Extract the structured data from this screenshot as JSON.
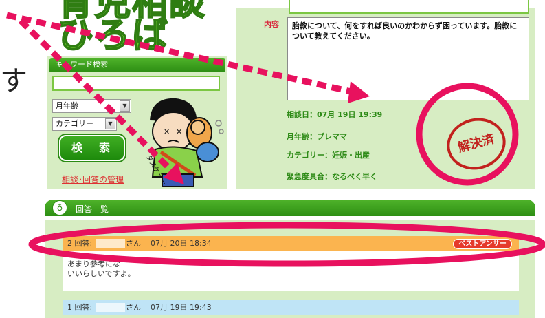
{
  "edge_text": "す",
  "logo": {
    "line1": "育児相談",
    "line2": "ひろば"
  },
  "sidebar": {
    "keyword_header": "キーワード検索",
    "month_select": "月年齢",
    "category_select": "カテゴリー",
    "search_button": "検　索",
    "manage_link": "相談･回答の管理",
    "character_caption": "タスケテー"
  },
  "consultation": {
    "content_label": "内容",
    "content_text": "胎教について、何をすれば良いのかわからず困っています。胎教について教えてください。",
    "date": "相談日：07月 19日 19:39",
    "age": "月年齢：プレママ",
    "category": "カテゴリー：妊娠・出産",
    "urgency": "緊急度具合：なるべく早く",
    "stamp": "解決済"
  },
  "answers": {
    "title": "回答一覧",
    "items": [
      {
        "number": "2 回答:",
        "user_suffix": "さん",
        "date": "07月 20日 18:34",
        "badge": "ベストアンサー",
        "body_start": "あまり参考にな",
        "body_end": "いいらしいですよ。"
      },
      {
        "number": "1 回答:",
        "user_suffix": "さん",
        "date": "07月 19日 19:43"
      }
    ]
  },
  "colors": {
    "green": "#2e8f14",
    "light_green": "#d7edc3",
    "annotation_pink": "#e8115e",
    "best_answer_row": "#fbb44f",
    "answer_row": "#bfe4f6",
    "stamp_red": "#c2211d"
  }
}
